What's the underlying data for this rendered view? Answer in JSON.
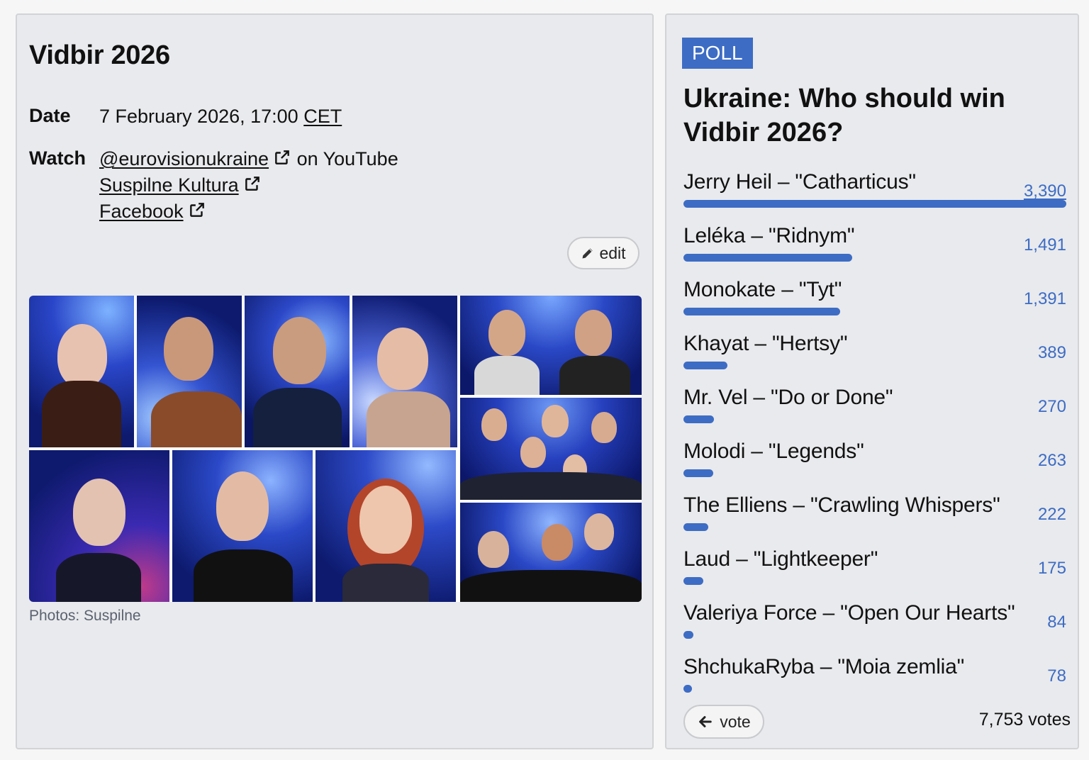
{
  "event": {
    "title": "Vidbir 2026",
    "date_label": "Date",
    "date_value": "7 February 2026, 17:00",
    "timezone": "CET",
    "watch_label": "Watch",
    "youtube_link": "@eurovisionukraine",
    "youtube_suffix": "on YouTube",
    "suspilne_link": "Suspilne Kultura",
    "facebook_link": "Facebook",
    "edit_label": "edit",
    "photo_credit": "Photos: Suspilne"
  },
  "poll": {
    "badge": "POLL",
    "question": "Ukraine: Who should win Vidbir 2026?",
    "options": [
      {
        "label": "Jerry Heil – \"Catharticus\"",
        "votes": "3,390",
        "share": 1.0
      },
      {
        "label": "Leléka – \"Ridnym\"",
        "votes": "1,491",
        "share": 0.44
      },
      {
        "label": "Monokate – \"Tyt\"",
        "votes": "1,391",
        "share": 0.41
      },
      {
        "label": "Khayat – \"Hertsy\"",
        "votes": "389",
        "share": 0.115
      },
      {
        "label": "Mr. Vel – \"Do or Done\"",
        "votes": "270",
        "share": 0.08
      },
      {
        "label": "Molodi – \"Legends\"",
        "votes": "263",
        "share": 0.078
      },
      {
        "label": "The Elliens – \"Crawling Whispers\"",
        "votes": "222",
        "share": 0.065
      },
      {
        "label": "Laud – \"Lightkeeper\"",
        "votes": "175",
        "share": 0.052
      },
      {
        "label": "Valeriya Force – \"Open Our Hearts\"",
        "votes": "84",
        "share": 0.025
      },
      {
        "label": "ShchukaRyba – \"Moia zemlia\"",
        "votes": "78",
        "share": 0.023
      }
    ],
    "vote_label": "vote",
    "total": "7,753 votes"
  },
  "colors": {
    "accent": "#3d6cc4",
    "card_bg": "#e9eaed",
    "photo_bg": "#1a2f9a"
  }
}
